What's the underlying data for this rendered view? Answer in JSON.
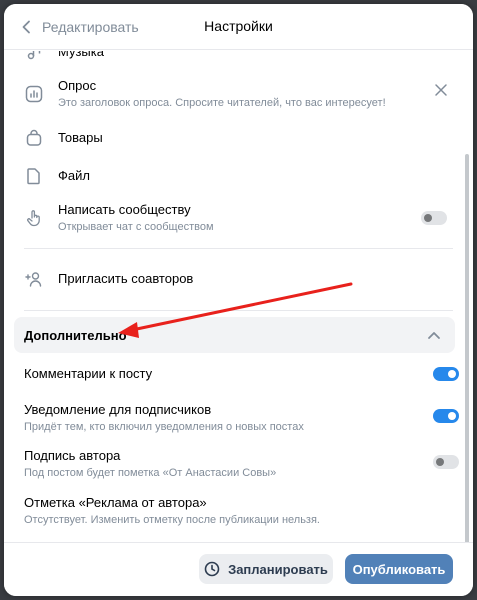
{
  "header": {
    "back_label": "Редактировать",
    "title": "Настройки"
  },
  "items": {
    "music_partial": "Музыка",
    "poll": {
      "label": "Опрос",
      "sub": "Это заголовок опроса. Спросите читателей, что вас интересует!"
    },
    "goods": "Товары",
    "file": "Файл",
    "message": {
      "label": "Написать сообществу",
      "sub": "Открывает чат с сообществом",
      "toggle": false
    },
    "invite": "Пригласить соавторов"
  },
  "advanced": {
    "title": "Дополнительно",
    "comments": {
      "label": "Комментарии к посту",
      "toggle": true
    },
    "notify": {
      "label": "Уведомление для подписчиков",
      "sub": "Придёт тем, кто включил уведомления о новых постах",
      "toggle": true
    },
    "signature": {
      "label": "Подпись автора",
      "sub": "Под постом будет пометка «От Анастасии Совы»",
      "toggle": false
    },
    "ad_mark": {
      "label": "Отметка «Реклама от автора»",
      "sub": "Отсутствует. Изменить отметку после публикации нельзя."
    }
  },
  "footer": {
    "schedule_label": "Запланировать",
    "publish_label": "Опубликовать"
  },
  "colors": {
    "accent": "#2688eb",
    "publish": "#5181b8",
    "annotation_arrow": "#e8211c"
  }
}
